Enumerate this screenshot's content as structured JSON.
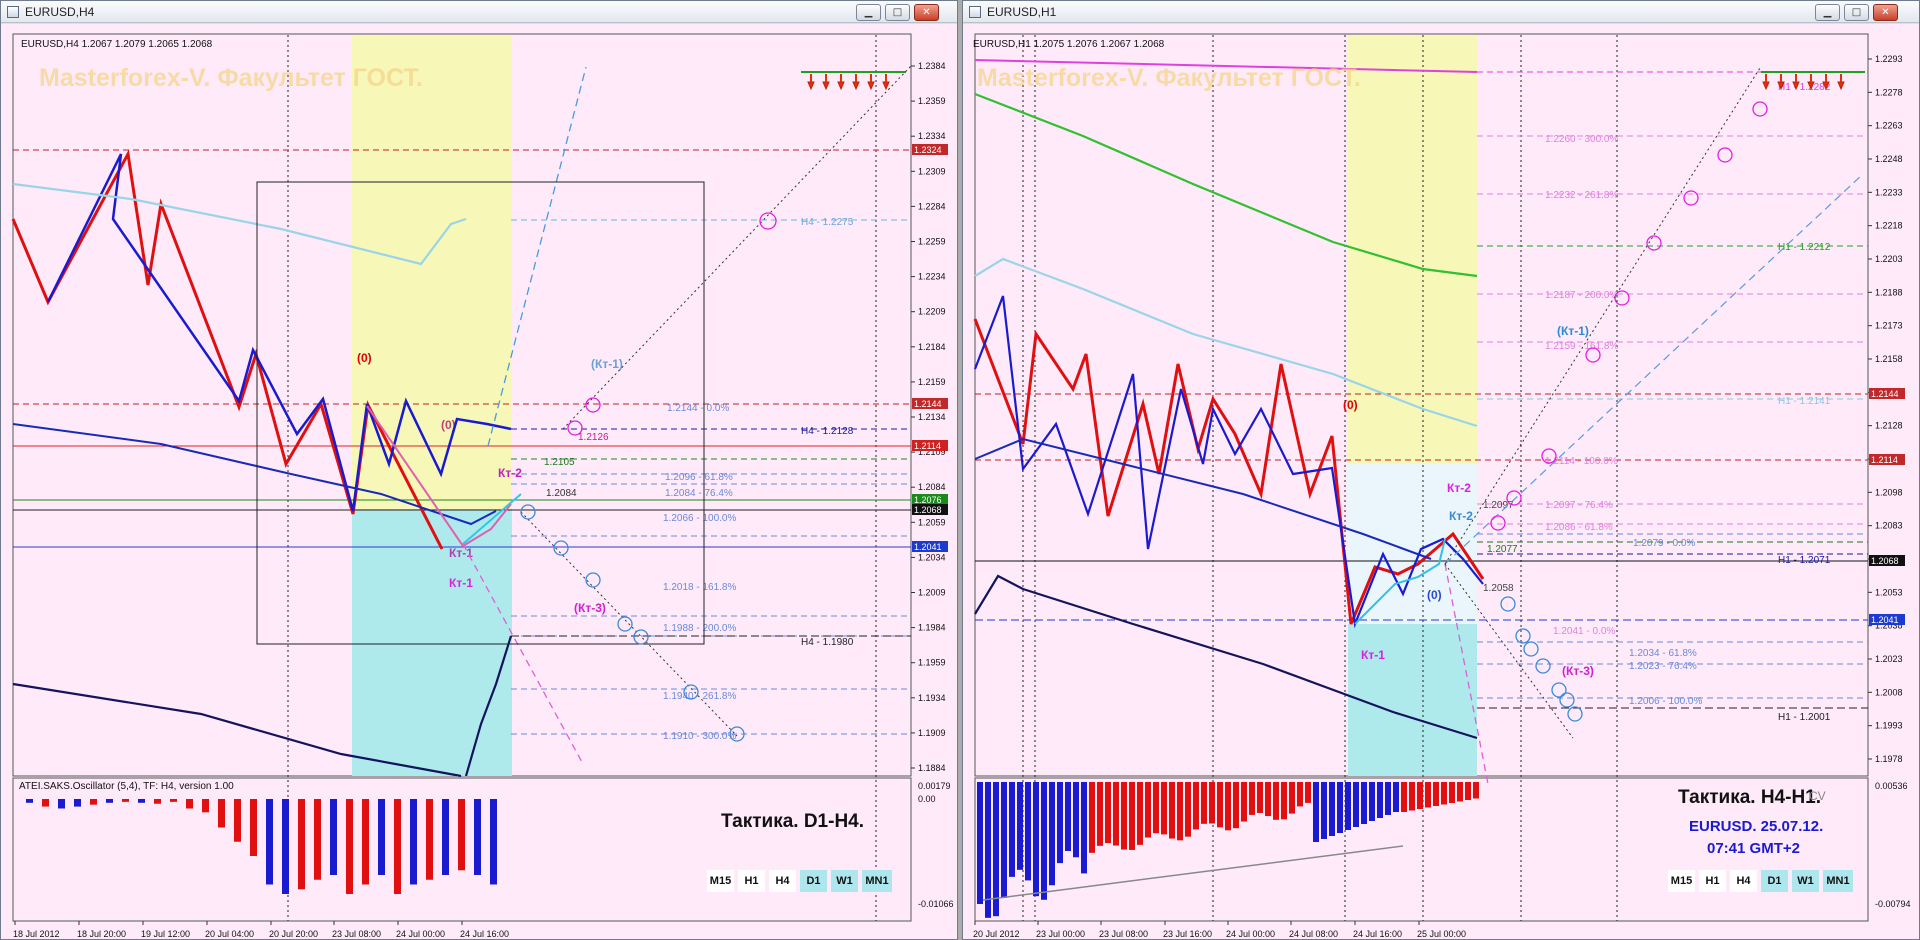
{
  "left": {
    "title": "EURUSD,H4",
    "symbol_line": "EURUSD,H4  1.2067 1.2079 1.2065 1.2068",
    "watermark": "Masterforex-V. Факультет ГОСТ.",
    "indicator_line": "ATEI.SAKS.Oscillator (5,4), TF: H4, version 1.00",
    "tactic": "Тактика. D1-H4.",
    "price_ticks": [
      "1.2384",
      "1.2359",
      "1.2334",
      "1.2309",
      "1.2284",
      "1.2259",
      "1.2234",
      "1.2209",
      "1.2184",
      "1.2159",
      "1.2134",
      "1.2109",
      "1.2084",
      "1.2059",
      "1.2034",
      "1.2009",
      "1.1984",
      "1.1959",
      "1.1934",
      "1.1909",
      "1.1884"
    ],
    "osc_ticks": [
      "0.00179",
      "0.00",
      "-0.01066"
    ],
    "time_ticks": [
      "18 Jul 2012",
      "18 Jul 20:00",
      "19 Jul 12:00",
      "20 Jul 04:00",
      "20 Jul 20:00",
      "23 Jul 08:00",
      "24 Jul 00:00",
      "24 Jul 16:00"
    ],
    "price_boxes": [
      {
        "text": "1.2324",
        "color": "#c0282a"
      },
      {
        "text": "1.2144",
        "color": "#c0282a"
      },
      {
        "text": "1.2114",
        "color": "#d02020"
      },
      {
        "text": "1.2076",
        "color": "#1a8a1a"
      },
      {
        "text": "1.2068",
        "color": "#111111"
      },
      {
        "text": "1.2041",
        "color": "#1a3ad0"
      }
    ],
    "level_labels": [
      {
        "text": "H4 - 1.2275",
        "color": "#6aa8d8"
      },
      {
        "text": "1.2144 - 0.0%",
        "color": "#6a8ad8"
      },
      {
        "text": "H4 - 1.2128",
        "color": "#1a1aa0"
      },
      {
        "text": "1.2126",
        "color": "#c02090"
      },
      {
        "text": "1.2105",
        "color": "#1a7a1a"
      },
      {
        "text": "1.2096 - 61.8%",
        "color": "#6a8ad8"
      },
      {
        "text": "1.2084 - 76.4%",
        "color": "#6a8ad8"
      },
      {
        "text": "1.2084",
        "color": "#333333"
      },
      {
        "text": "1.2066 - 100.0%",
        "color": "#6a8ad8"
      },
      {
        "text": "1.2018 - 161.8%",
        "color": "#6a8ad8"
      },
      {
        "text": "1.1988 - 200.0%",
        "color": "#6a8ad8"
      },
      {
        "text": "H4 - 1.1980",
        "color": "#222222"
      },
      {
        "text": "1.1940 - 261.8%",
        "color": "#6a8ad8"
      },
      {
        "text": "1.1910 - 300.0%",
        "color": "#6a8ad8"
      }
    ],
    "markers": [
      {
        "text": "(0)",
        "color": "#e00000"
      },
      {
        "text": "(0)",
        "color": "#c04070"
      },
      {
        "text": "(Кт-1)",
        "color": "#6aa0d8"
      },
      {
        "text": "Кт-2",
        "color": "#c020c0"
      },
      {
        "text": "Кт-1",
        "color": "#b040b0"
      },
      {
        "text": "Кт-1",
        "color": "#e020e0"
      },
      {
        "text": "(Кт-3)",
        "color": "#d020d0"
      }
    ],
    "timeframes": [
      {
        "label": "M15",
        "active": false
      },
      {
        "label": "H1",
        "active": false
      },
      {
        "label": "H4",
        "active": false
      },
      {
        "label": "D1",
        "active": true
      },
      {
        "label": "W1",
        "active": true
      },
      {
        "label": "MN1",
        "active": true
      }
    ]
  },
  "right": {
    "title": "EURUSD,H1",
    "symbol_line": "EURUSD,H1  1.2075 1.2076 1.2067 1.2068",
    "watermark": "Masterforex-V. Факультет ГОСТ.",
    "tactic": "Тактика. H4-H1.",
    "cv": "CV",
    "stamp_line1": "EURUSD. 25.07.12.",
    "stamp_line2": "07:41  GMT+2",
    "price_ticks": [
      "1.2293",
      "1.2278",
      "1.2263",
      "1.2248",
      "1.2233",
      "1.2218",
      "1.2203",
      "1.2188",
      "1.2173",
      "1.2158",
      "1.2143",
      "1.2128",
      "1.2113",
      "1.2098",
      "1.2083",
      "1.2068",
      "1.2053",
      "1.2038",
      "1.2023",
      "1.2008",
      "1.1993",
      "1.1978"
    ],
    "osc_ticks": [
      "0.00536",
      "-0.00794"
    ],
    "time_ticks": [
      "20 Jul 2012",
      "23 Jul 00:00",
      "23 Jul 08:00",
      "23 Jul 16:00",
      "24 Jul 00:00",
      "24 Jul 08:00",
      "24 Jul 16:00",
      "25 Jul 00:00"
    ],
    "price_boxes": [
      {
        "text": "1.2144",
        "color": "#c0282a"
      },
      {
        "text": "1.2114",
        "color": "#c0282a"
      },
      {
        "text": "1.2068",
        "color": "#111111"
      },
      {
        "text": "1.2041",
        "color": "#1a3ad0"
      }
    ],
    "level_labels": [
      {
        "text": "H1 - 1.2282",
        "color": "#e040e0"
      },
      {
        "text": "1.2260 - 300.0%",
        "color": "#e080e0"
      },
      {
        "text": "1.2232 - 261.8%",
        "color": "#e080e0"
      },
      {
        "text": "H1 - 1.2212",
        "color": "#20a020"
      },
      {
        "text": "1.2187 - 200.0%",
        "color": "#e080e0"
      },
      {
        "text": "1.2159 - 161.8%",
        "color": "#e080e0"
      },
      {
        "text": "H1 - 1.2141",
        "color": "#8ac8e0"
      },
      {
        "text": "1.2114 - 100.0%",
        "color": "#e080e0"
      },
      {
        "text": "1.2097",
        "color": "#444444"
      },
      {
        "text": "1.2097 - 76.4%",
        "color": "#e080e0"
      },
      {
        "text": "1.2086 - 61.8%",
        "color": "#e080e0"
      },
      {
        "text": "1.2079 - 0.0%",
        "color": "#6a8ad8"
      },
      {
        "text": "1.2077",
        "color": "#1a7a1a"
      },
      {
        "text": "H1 - 1.2071",
        "color": "#1a1aa0"
      },
      {
        "text": "1.2058",
        "color": "#444444"
      },
      {
        "text": "1.2041 - 0.0%",
        "color": "#e080e0"
      },
      {
        "text": "1.2034 - 61.8%",
        "color": "#6a8ad8"
      },
      {
        "text": "1.2023 - 76.4%",
        "color": "#6a8ad8"
      },
      {
        "text": "1.2006 - 100.0%",
        "color": "#6a8ad8"
      },
      {
        "text": "H1 - 1.2001",
        "color": "#222222"
      }
    ],
    "markers": [
      {
        "text": "(0)",
        "color": "#e00000"
      },
      {
        "text": "(Кт-1)",
        "color": "#2a8ad8"
      },
      {
        "text": "Кт-2",
        "color": "#e020e0"
      },
      {
        "text": "Кт-2",
        "color": "#3a8ad0"
      },
      {
        "text": "Кт-1",
        "color": "#e020e0"
      },
      {
        "text": "(0)",
        "color": "#2a4ad0"
      },
      {
        "text": "(Кт-3)",
        "color": "#d020d0"
      }
    ],
    "timeframes": [
      {
        "label": "M15",
        "active": false
      },
      {
        "label": "H1",
        "active": false
      },
      {
        "label": "H4",
        "active": false
      },
      {
        "label": "D1",
        "active": true
      },
      {
        "label": "W1",
        "active": true
      },
      {
        "label": "MN1",
        "active": true
      }
    ]
  },
  "window_buttons": {
    "minimize": "▁",
    "maximize": "□",
    "close": "✕"
  },
  "colors": {
    "bull": "#1a1ad0",
    "bear": "#e01010",
    "background": "#ffeafa",
    "yellow_zone": "#f7f7b8",
    "cyan_zone": "#aee9ec"
  }
}
